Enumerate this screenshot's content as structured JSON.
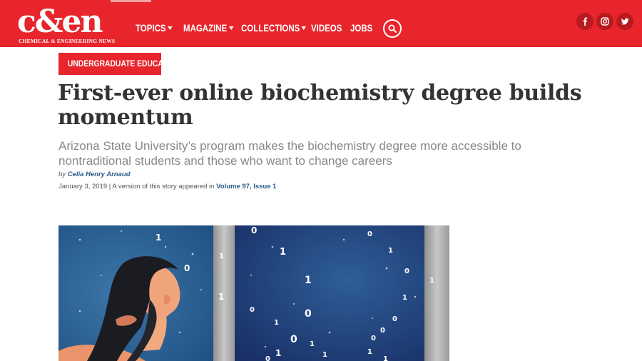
{
  "brand": {
    "logo_text": "c&en",
    "tagline": "CHEMICAL & ENGINEERING NEWS"
  },
  "nav": [
    {
      "label": "TOPICS",
      "has_dropdown": true
    },
    {
      "label": "MAGAZINE",
      "has_dropdown": true
    },
    {
      "label": "COLLECTIONS",
      "has_dropdown": true
    },
    {
      "label": "VIDEOS",
      "has_dropdown": false
    },
    {
      "label": "JOBS",
      "has_dropdown": false
    }
  ],
  "icons": {
    "search": "search-icon",
    "social": [
      "facebook-icon",
      "instagram-icon",
      "twitter-icon"
    ]
  },
  "colors": {
    "brand_red": "#e8252c",
    "social_circle": "#b81a20",
    "link_blue": "#2a5a8c",
    "headline": "#333333",
    "subhead": "#888888"
  },
  "article": {
    "category": "UNDERGRADUATE EDUCATION",
    "headline": "First-ever online biochemistry degree builds momentum",
    "subhead": "Arizona State University’s program makes the biochemistry degree more accessible to nontraditional students and those who want to change careers",
    "byline_prefix": "by",
    "author": "Celia Henry Arnaud",
    "date": "January 3, 2019",
    "appeared_text": " | A version of this story appeared in ",
    "issue_link": "Volume 97, Issue 1"
  },
  "hero": {
    "digits": [
      "1",
      "0",
      "1",
      "0",
      "1",
      "1",
      "0",
      "1",
      "0",
      "0",
      "1",
      "1",
      "1",
      "0",
      "0",
      "0",
      "1",
      "0",
      "1",
      "0",
      "1",
      "1",
      "0",
      "1",
      "1"
    ]
  }
}
